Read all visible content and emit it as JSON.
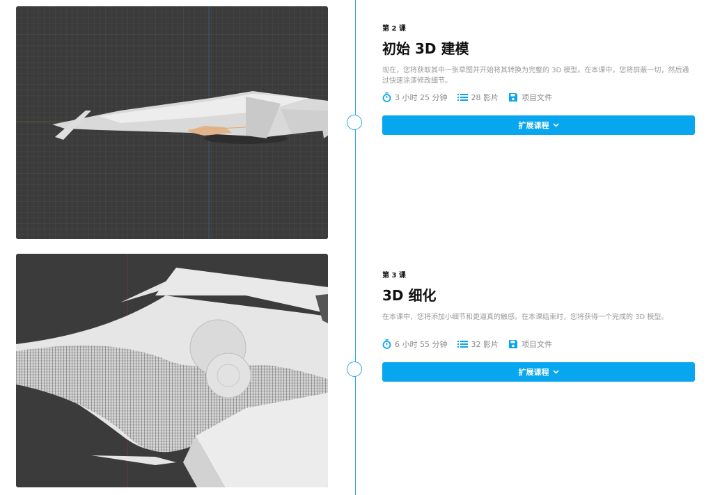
{
  "lessons": [
    {
      "label": "第 2 课",
      "title": "初始 3D 建模",
      "description": "现在，您将获取其中一张草图并开始将其转换为完整的 3D 模型。在本课中，您将屏蔽一切，然后通过快速涂漆修改细节。",
      "duration": "3 小时 25 分钟",
      "videos": "28 影片",
      "files": "项目文件",
      "expand_label": "扩展课程"
    },
    {
      "label": "第 3 课",
      "title": "3D 细化",
      "description": "在本课中，您将添加小细节和更逼真的触感。在本课结束时，您将获得一个完成的 3D 模型。",
      "duration": "6 小时 55 分钟",
      "videos": "32 影片",
      "files": "项目文件",
      "expand_label": "扩展课程"
    }
  ],
  "icons": {
    "duration": "stopwatch-icon",
    "videos": "list-icon",
    "files": "floppy-disk-icon",
    "expand": "chevron-down-icon"
  },
  "colors": {
    "accent": "#08a6ee",
    "timeline": "#2aa7ea",
    "viewport_bg": "#3b3b3b",
    "model": "#e6e6e6"
  }
}
